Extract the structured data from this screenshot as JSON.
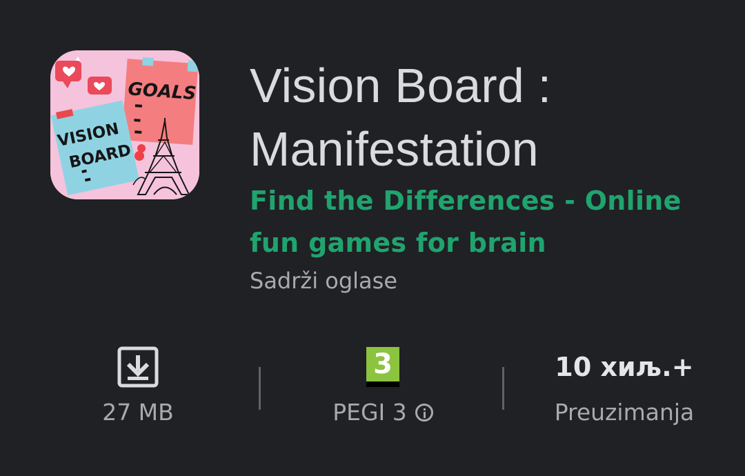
{
  "app": {
    "title_lines": [
      "Vision Board :",
      "Manifestation"
    ],
    "developer_lines": [
      "Find the Differences - Online",
      "fun games for brain"
    ],
    "ads_notice": "Sadrži oglase",
    "icon_text": {
      "vision": "VISION",
      "board": "BOARD",
      "goals": "GOALS"
    }
  },
  "stats": {
    "size": {
      "icon": "download-icon",
      "label": "27 MB"
    },
    "rating": {
      "badge_value": "3",
      "label": "PEGI 3",
      "info_icon": "info-icon",
      "badge_color": "#8cc33f"
    },
    "downloads": {
      "value": "10 хиљ.+",
      "label": "Preuzimanja"
    }
  },
  "colors": {
    "background": "#202124",
    "title": "#dadbdd",
    "developer": "#20a46f",
    "secondary_text": "#a8aaad"
  }
}
